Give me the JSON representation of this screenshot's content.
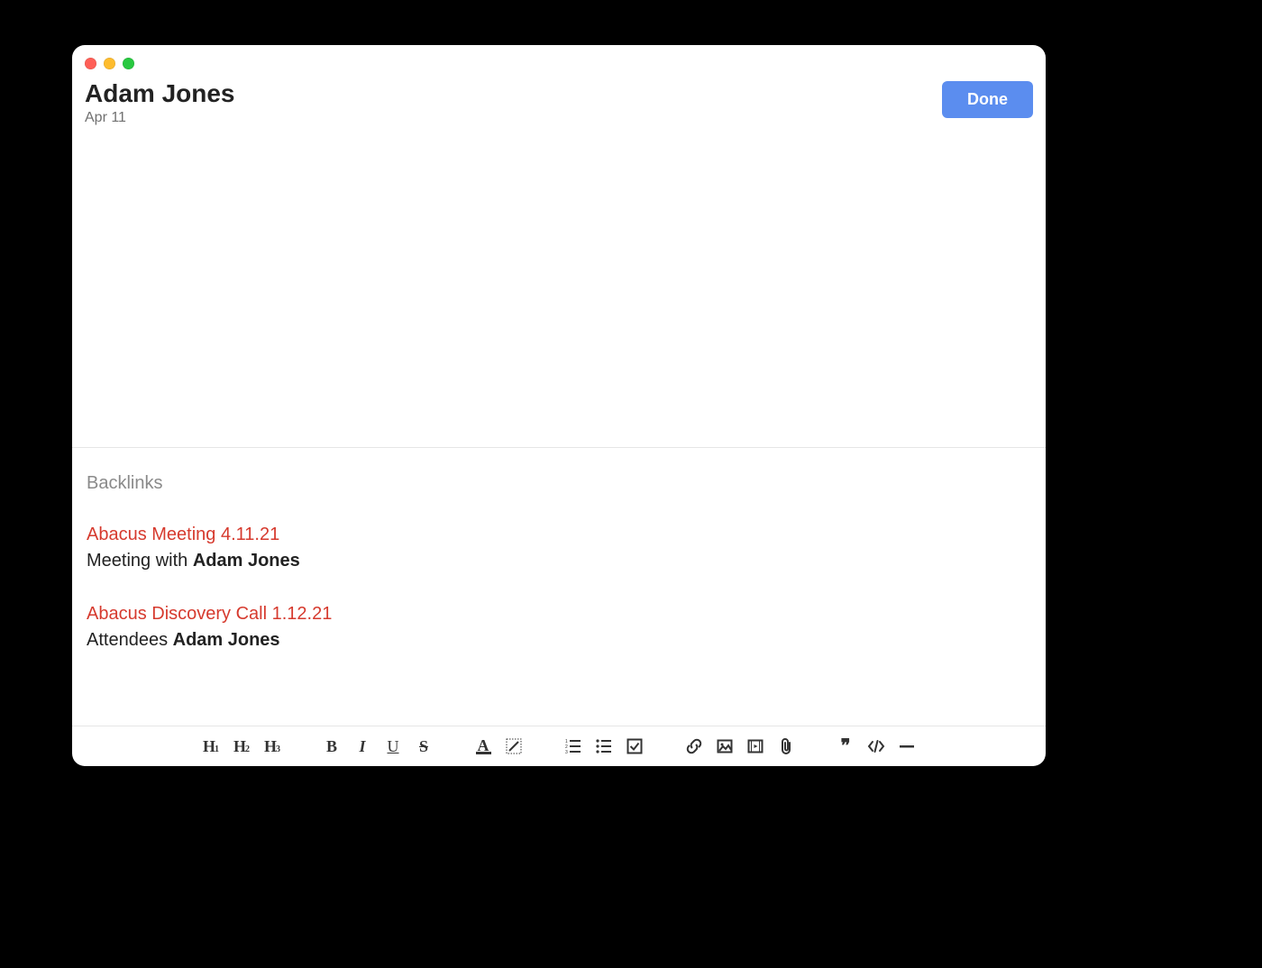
{
  "header": {
    "title": "Adam Jones",
    "date": "Apr 11",
    "done_label": "Done"
  },
  "backlinks": {
    "label": "Backlinks",
    "items": [
      {
        "title": "Abacus Meeting 4.11.21",
        "snippet_prefix": "Meeting with ",
        "snippet_highlight": "Adam Jones"
      },
      {
        "title": "Abacus Discovery Call 1.12.21",
        "snippet_prefix": "Attendees ",
        "snippet_highlight": "Adam Jones"
      }
    ]
  },
  "toolbar": {
    "h1": "H",
    "h1_sub": "1",
    "h2": "H",
    "h2_sub": "2",
    "h3": "H",
    "h3_sub": "3",
    "bold": "B",
    "italic": "I",
    "underline": "U",
    "strike": "S",
    "textcolor": "A",
    "quote_glyph": "❞"
  },
  "colors": {
    "link": "#d63a2e",
    "primary_button": "#5b8def"
  }
}
